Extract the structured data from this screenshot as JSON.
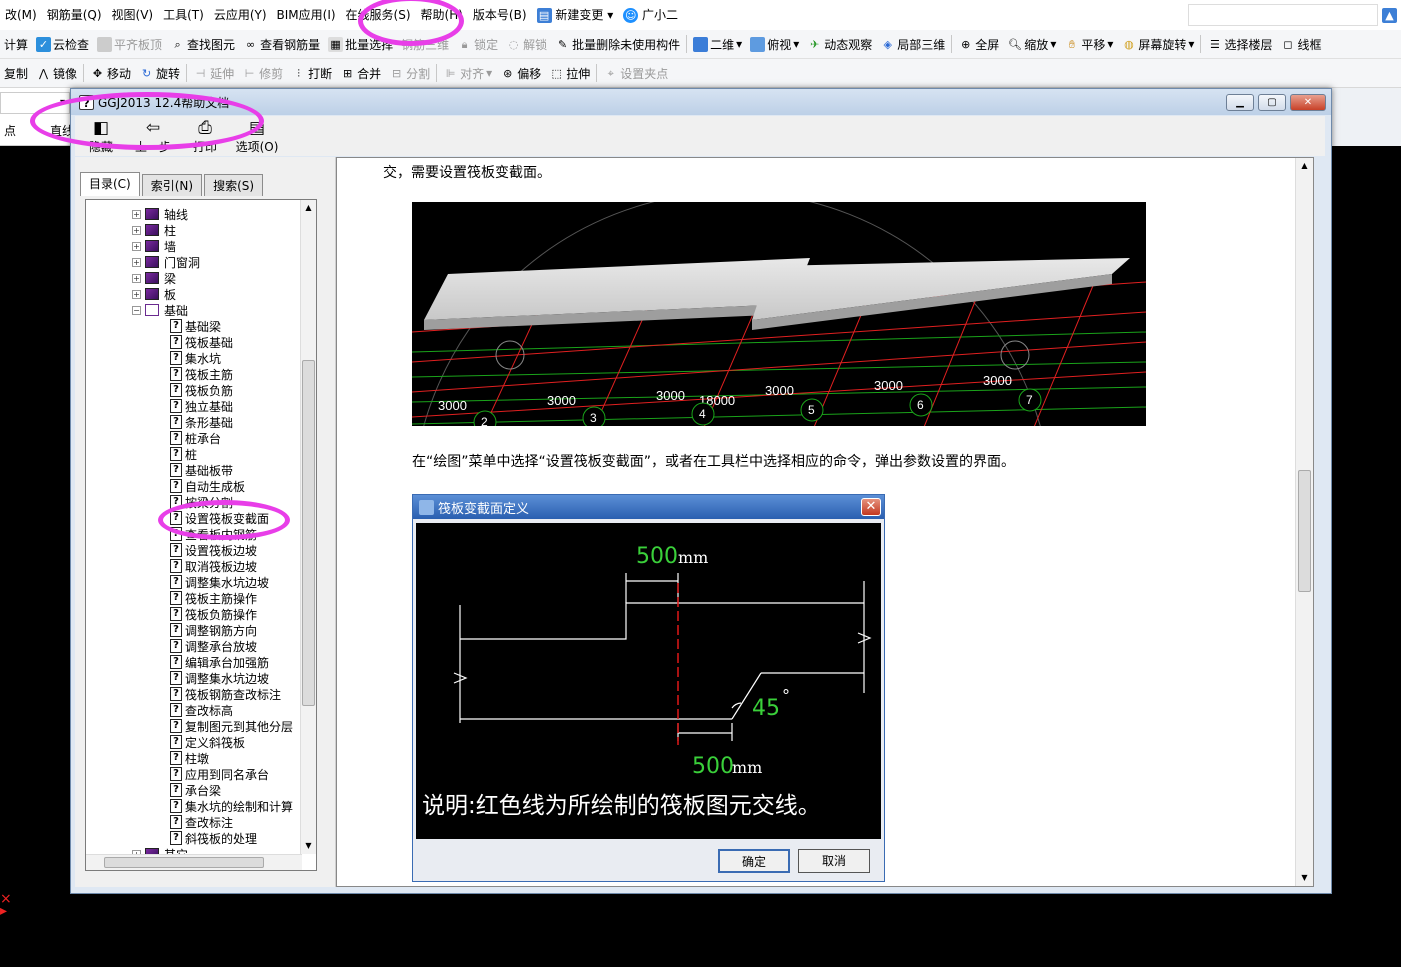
{
  "menu": [
    "改(M)",
    "钢筋量(Q)",
    "视图(V)",
    "工具(T)",
    "云应用(Y)",
    "BIM应用(I)",
    "在线服务(S)",
    "帮助(H)",
    "版本号(B)",
    "新建变更",
    "广小二"
  ],
  "toolbar1": [
    "计算",
    "云检查",
    "平齐板顶",
    "查找图元",
    "查看钢筋量",
    "批量选择",
    "钢筋三维",
    "锁定",
    "解锁",
    "批量删除未使用构件",
    "二维",
    "俯视",
    "动态观察",
    "局部三维",
    "全屏",
    "缩放",
    "平移",
    "屏幕旋转",
    "选择楼层",
    "线框"
  ],
  "toolbar2": [
    "复制",
    "镜像",
    "移动",
    "旋转",
    "延伸",
    "修剪",
    "打断",
    "合并",
    "分割",
    "对齐",
    "偏移",
    "拉伸",
    "设置夹点"
  ],
  "left_row": [
    "点",
    "直线"
  ],
  "help": {
    "title": "GGJ2013 12.4帮助文档",
    "tools": [
      "隐藏",
      "上一步",
      "打印",
      "选项(O)"
    ],
    "tabs": [
      "目录(C)",
      "索引(N)",
      "搜索(S)"
    ],
    "tree_top": [
      "轴线",
      "柱",
      "墙",
      "门窗洞",
      "梁",
      "板"
    ],
    "tree_open": "基础",
    "tree_children": [
      "基础梁",
      "筏板基础",
      "集水坑",
      "筏板主筋",
      "筏板负筋",
      "独立基础",
      "条形基础",
      "桩承台",
      "桩",
      "基础板带",
      "自动生成板",
      "按梁分割",
      "设置筏板变截面",
      "查看板内钢筋",
      "设置筏板边坡",
      "取消筏板边坡",
      "调整集水坑边坡",
      "筏板主筋操作",
      "筏板负筋操作",
      "调整钢筋方向",
      "调整承台放坡",
      "编辑承台加强筋",
      "调整集水坑边坡",
      "筏板钢筋查改标注",
      "查改标高",
      "复制图元到其他分层",
      "定义斜筏板",
      "柱墩",
      "应用到同名承台",
      "承台梁",
      "集水坑的绘制和计算",
      "查改标注",
      "斜筏板的处理"
    ],
    "tree_last": "其它",
    "text1": "交，需要设置筏板变截面。",
    "text2": "在“绘图”菜单中选择“设置筏板变截面”，或者在工具栏中选择相应的命令，弹出参数设置的界面。",
    "img_dims": [
      "3000",
      "3000",
      "3000",
      "18000",
      "3000",
      "3000",
      "3000"
    ],
    "img_axes": [
      "2",
      "3",
      "4",
      "5",
      "6",
      "7"
    ],
    "img_side": "3000"
  },
  "dialog": {
    "title": "筏板变截面定义",
    "top_val": "500",
    "top_unit": "mm",
    "angle": "45",
    "deg": "°",
    "bottom_val": "500",
    "bottom_unit": "mm",
    "note": "说明:红色线为所绘制的筏板图元交线。",
    "ok": "确定",
    "cancel": "取消"
  }
}
